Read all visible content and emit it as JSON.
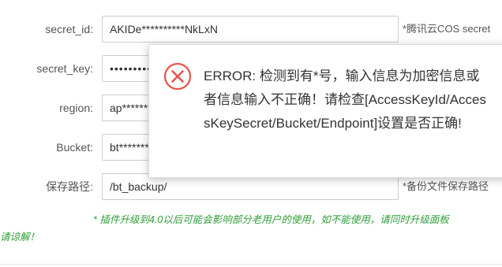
{
  "form": {
    "rows": [
      {
        "label": "secret_id:",
        "value": "AKIDe**********NkLxN",
        "hint": "*腾讯云COS secret"
      },
      {
        "label": "secret_key:",
        "value": "••••••••••••••••••••••",
        "hint": ""
      },
      {
        "label": "region:",
        "value": "ap********",
        "hint": ""
      },
      {
        "label": "Bucket:",
        "value": "bt********",
        "hint": ""
      },
      {
        "label": "保存路径:",
        "value": "/bt_backup/",
        "hint": "*备份文件保存路径"
      }
    ]
  },
  "notice": {
    "line1": "* 插件升级到4.0以后可能会影响部分老用户的使用，如不能使用，请同时升级面板",
    "line2": "请谅解！"
  },
  "dialog": {
    "icon": "error-x-icon",
    "icon_color": "#e8534e",
    "message": "ERROR: 检测到有*号，输入信息为加密信息或者信息输入不正确！请检查[AccessKeyId/AccessKeySecret/Bucket/Endpoint]设置是否正确!"
  }
}
